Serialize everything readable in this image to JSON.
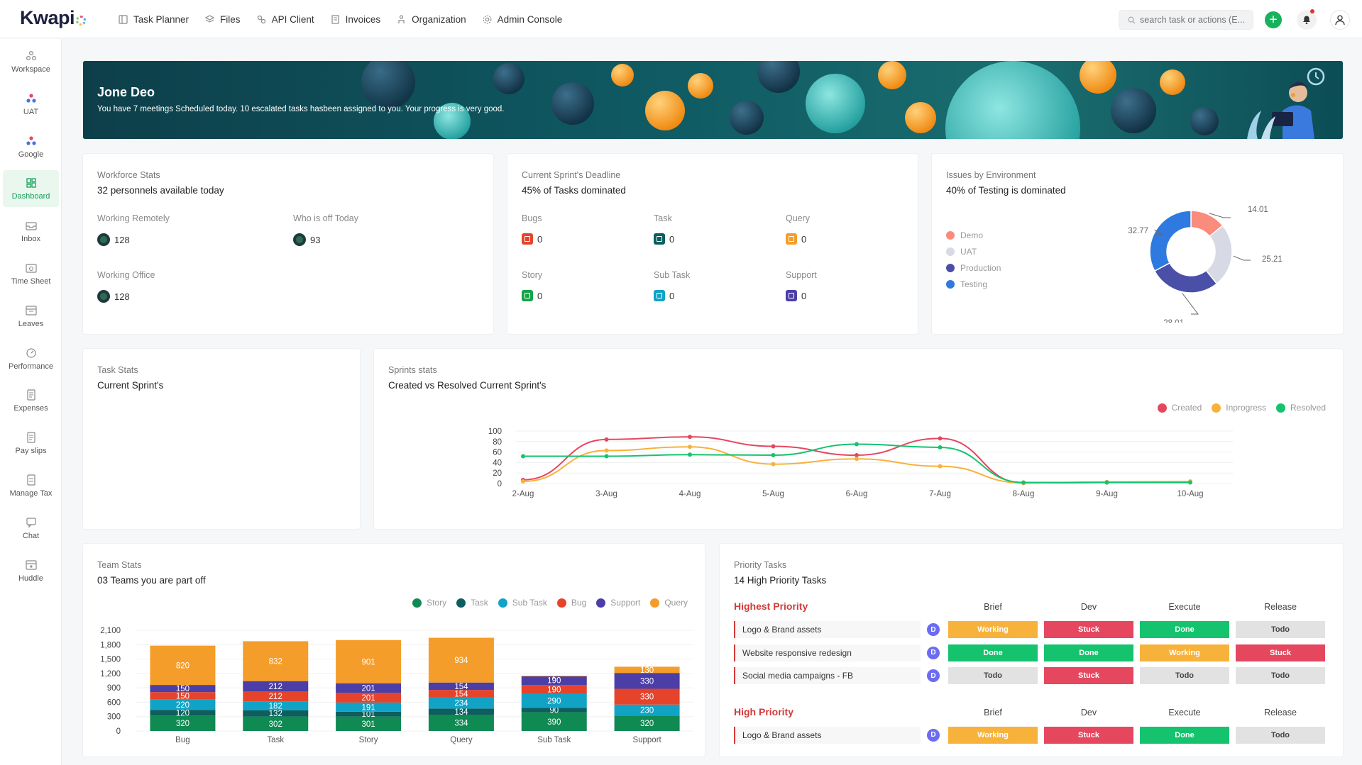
{
  "app": {
    "logo": "Kwapi"
  },
  "nav": [
    {
      "label": "Task Planner",
      "icon": "task-planner-icon"
    },
    {
      "label": "Files",
      "icon": "files-icon"
    },
    {
      "label": "API Client",
      "icon": "api-client-icon"
    },
    {
      "label": "Invoices",
      "icon": "invoices-icon"
    },
    {
      "label": "Organization",
      "icon": "organization-icon"
    },
    {
      "label": "Admin Console",
      "icon": "gear-icon"
    }
  ],
  "search": {
    "placeholder": "search task or actions (E..."
  },
  "sidebar": [
    {
      "label": "Workspace",
      "icon": "workspace-icon"
    },
    {
      "label": "UAT",
      "icon": "uat-icon"
    },
    {
      "label": "Google",
      "icon": "google-icon"
    },
    {
      "label": "Dashboard",
      "icon": "dashboard-icon",
      "active": true
    },
    {
      "label": "Inbox",
      "icon": "inbox-icon"
    },
    {
      "label": "Time Sheet",
      "icon": "timesheet-icon"
    },
    {
      "label": "Leaves",
      "icon": "leaves-icon"
    },
    {
      "label": "Performance",
      "icon": "performance-icon"
    },
    {
      "label": "Expenses",
      "icon": "expenses-icon"
    },
    {
      "label": "Pay slips",
      "icon": "payslips-icon"
    },
    {
      "label": "Manage Tax",
      "icon": "tax-icon"
    },
    {
      "label": "Chat",
      "icon": "chat-icon"
    },
    {
      "label": "Huddle",
      "icon": "huddle-icon"
    }
  ],
  "banner": {
    "name": "Jone Deo",
    "message": "You have 7 meetings Scheduled today. 10 escalated tasks hasbeen assigned to you. Your progress is very good."
  },
  "workforce": {
    "title": "Workforce Stats",
    "subtitle": "32 personnels available today",
    "stats": [
      {
        "label": "Working Remotely",
        "value": "128"
      },
      {
        "label": "Who is off Today",
        "value": "93"
      },
      {
        "label": "Working Office",
        "value": "128"
      }
    ]
  },
  "sprint_deadline": {
    "title": "Current Sprint's Deadline",
    "subtitle": "45% of Tasks dominated",
    "items": [
      {
        "label": "Bugs",
        "value": "0",
        "color": "#e5442b"
      },
      {
        "label": "Task",
        "value": "0",
        "color": "#0d5e5e"
      },
      {
        "label": "Query",
        "value": "0",
        "color": "#f59d2a"
      },
      {
        "label": "Story",
        "value": "0",
        "color": "#17a34a"
      },
      {
        "label": "Sub Task",
        "value": "0",
        "color": "#11a3c6"
      },
      {
        "label": "Support",
        "value": "0",
        "color": "#4b3ea7"
      }
    ]
  },
  "issues_env": {
    "title": "Issues by Environment",
    "subtitle": "40% of Testing is dominated",
    "legend": [
      {
        "label": "Demo",
        "color": "#f98c7c"
      },
      {
        "label": "UAT",
        "color": "#d7d9e4"
      },
      {
        "label": "Production",
        "color": "#4a4fa8"
      },
      {
        "label": "Testing",
        "color": "#2f7ae0"
      }
    ],
    "chart_data": {
      "type": "pie",
      "categories": [
        "Demo",
        "UAT",
        "Production",
        "Testing"
      ],
      "values": [
        14.01,
        25.21,
        28.01,
        32.77
      ],
      "data_labels": [
        "14.01",
        "25.21",
        "28.01",
        "32.77"
      ]
    }
  },
  "task_stats": {
    "title": "Task Stats",
    "subtitle": "Current Sprint's"
  },
  "sprints_stats": {
    "title": "Sprints stats",
    "subtitle": "Created vs Resolved Current Sprint's",
    "legend": [
      {
        "label": "Created",
        "color": "#e5475f"
      },
      {
        "label": "Inprogress",
        "color": "#f7b23b"
      },
      {
        "label": "Resolved",
        "color": "#15c36e"
      }
    ],
    "chart_data": {
      "type": "line",
      "x": [
        "2-Aug",
        "3-Aug",
        "4-Aug",
        "5-Aug",
        "6-Aug",
        "7-Aug",
        "8-Aug",
        "9-Aug",
        "10-Aug"
      ],
      "ylim": [
        0,
        100
      ],
      "yticks": [
        "0",
        "20",
        "40",
        "60",
        "80",
        "100"
      ],
      "series": [
        {
          "name": "Created",
          "color": "#e5475f",
          "values": [
            7,
            84,
            89,
            71,
            54,
            86,
            1,
            2,
            3
          ]
        },
        {
          "name": "Inprogress",
          "color": "#f7b23b",
          "values": [
            4,
            63,
            70,
            37,
            47,
            33,
            1,
            3,
            4
          ]
        },
        {
          "name": "Resolved",
          "color": "#15c36e",
          "values": [
            52,
            52,
            55,
            54,
            75,
            69,
            2,
            2,
            2
          ]
        }
      ]
    }
  },
  "team_stats": {
    "title": "Team Stats",
    "subtitle": "03 Teams you are part off",
    "legend": [
      {
        "label": "Story",
        "color": "#0f8a53"
      },
      {
        "label": "Task",
        "color": "#0d5e5e"
      },
      {
        "label": "Sub Task",
        "color": "#11a3c6"
      },
      {
        "label": "Bug",
        "color": "#e5442b"
      },
      {
        "label": "Support",
        "color": "#4b3ea7"
      },
      {
        "label": "Query",
        "color": "#f59d2a"
      }
    ],
    "chart_data": {
      "type": "bar",
      "stacked": true,
      "categories": [
        "Bug",
        "Task",
        "Story",
        "Query",
        "Sub Task",
        "Support"
      ],
      "ylim": [
        0,
        2100
      ],
      "yticks": [
        "0",
        "300",
        "600",
        "900",
        "1,200",
        "1,500",
        "1,800",
        "2,100"
      ],
      "series": [
        {
          "name": "Story",
          "color": "#0f8a53",
          "values": [
            320,
            302,
            301,
            334,
            390,
            320
          ]
        },
        {
          "name": "Task",
          "color": "#0d5e5e",
          "values": [
            120,
            132,
            101,
            134,
            90,
            0
          ]
        },
        {
          "name": "Sub Task",
          "color": "#11a3c6",
          "values": [
            220,
            182,
            191,
            234,
            290,
            230
          ]
        },
        {
          "name": "Bug",
          "color": "#e5442b",
          "values": [
            150,
            212,
            201,
            154,
            190,
            330
          ]
        },
        {
          "name": "Support",
          "color": "#4b3ea7",
          "values": [
            150,
            212,
            201,
            154,
            190,
            330
          ]
        },
        {
          "name": "Query",
          "color": "#f59d2a",
          "values": [
            820,
            832,
            901,
            934,
            2,
            130
          ]
        }
      ]
    }
  },
  "priority": {
    "title": "Priority Tasks",
    "subtitle": "14 High Priority Tasks",
    "columns": [
      "Brief",
      "Dev",
      "Execute",
      "Release"
    ],
    "status_colors": {
      "Working": "#f7b23b",
      "Stuck": "#e5475f",
      "Done": "#15c36e",
      "Todo": "#e2e2e2"
    },
    "groups": [
      {
        "label": "Highest Priority",
        "rows": [
          {
            "name": "Logo & Brand assets",
            "avatar": "D",
            "statuses": [
              "Working",
              "Stuck",
              "Done",
              "Todo"
            ]
          },
          {
            "name": "Website responsive redesign",
            "avatar": "D",
            "statuses": [
              "Done",
              "Done",
              "Working",
              "Stuck"
            ]
          },
          {
            "name": "Social media campaigns - FB",
            "avatar": "D",
            "statuses": [
              "Todo",
              "Stuck",
              "Todo",
              "Todo"
            ]
          }
        ]
      },
      {
        "label": "High Priority",
        "rows": [
          {
            "name": "Logo & Brand assets",
            "avatar": "D",
            "statuses": [
              "Working",
              "Stuck",
              "Done",
              "Todo"
            ]
          }
        ]
      }
    ]
  }
}
